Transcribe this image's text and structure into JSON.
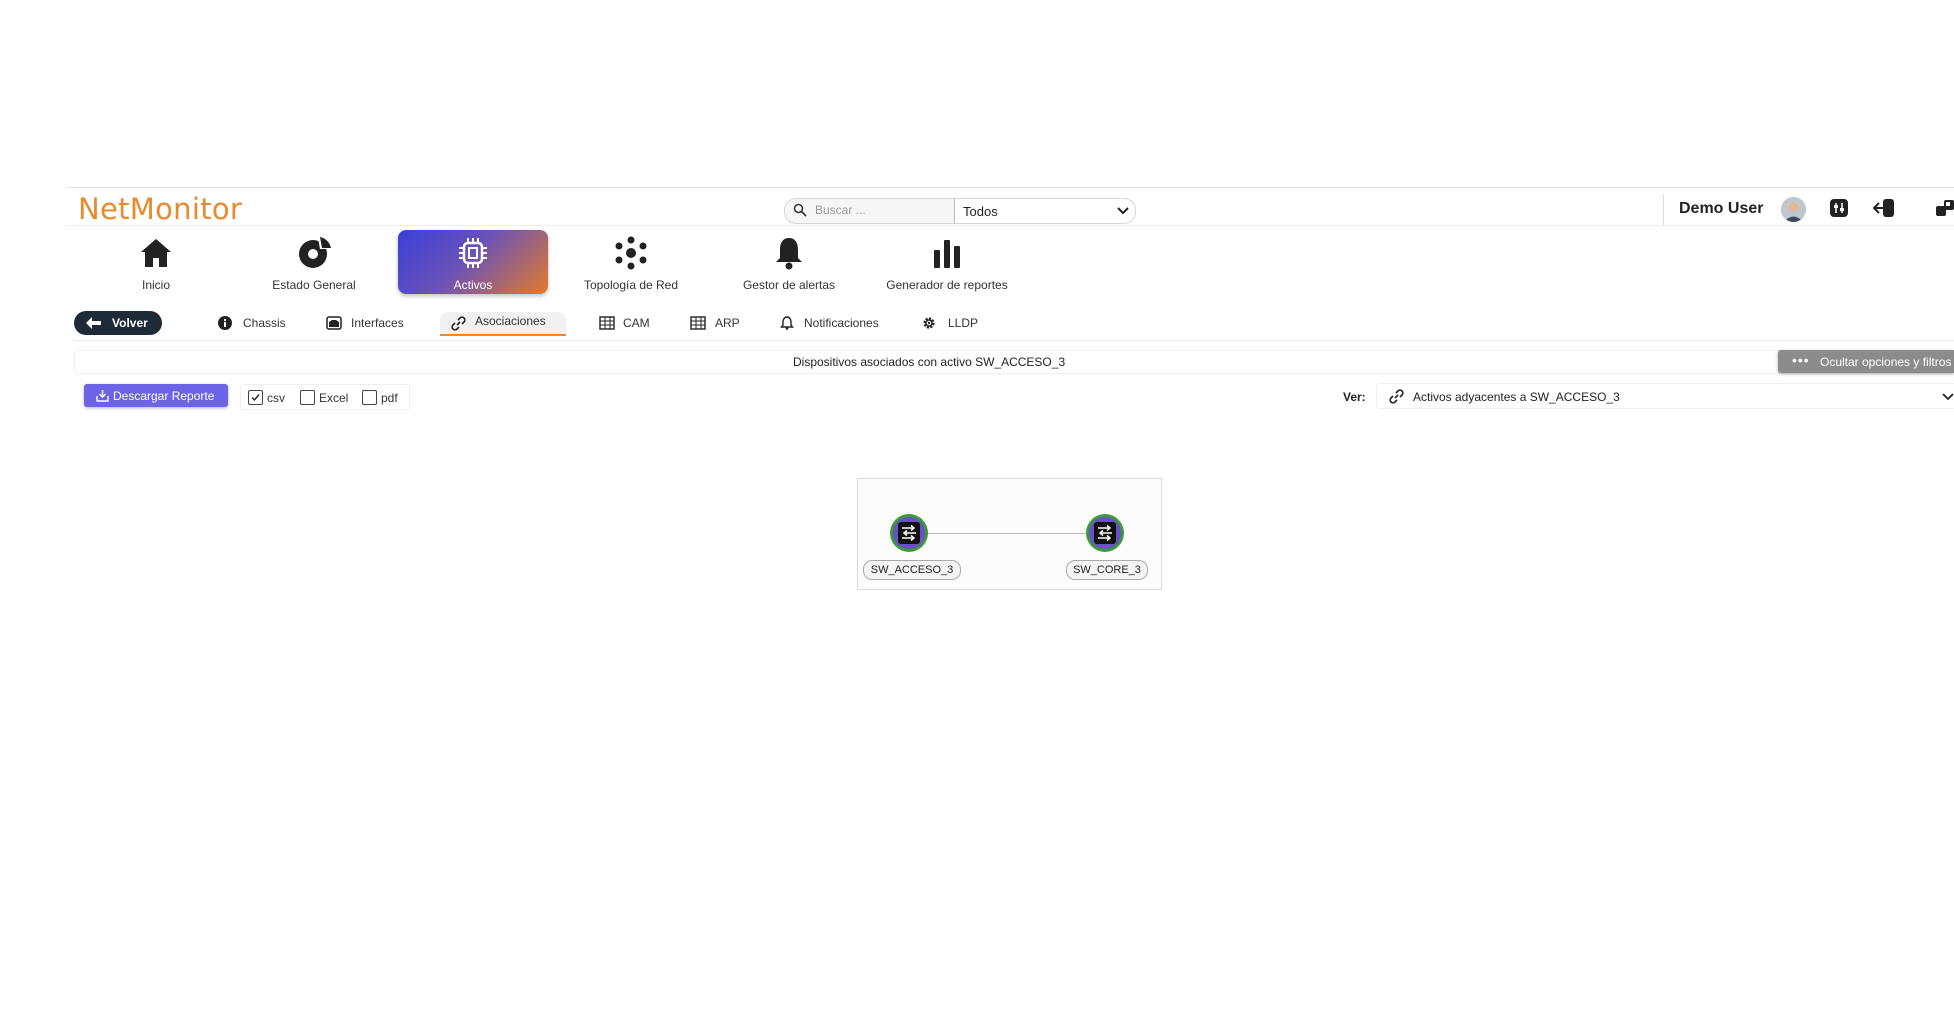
{
  "header": {
    "logo": "NetMonitor",
    "search_placeholder": "Buscar ...",
    "search_scope": "Todos",
    "username": "Demo User"
  },
  "nav": {
    "items": [
      {
        "label": "Inicio",
        "icon": "home-icon"
      },
      {
        "label": "Estado General",
        "icon": "status-icon"
      },
      {
        "label": "Activos",
        "icon": "chip-icon",
        "active": true
      },
      {
        "label": "Topología de Red",
        "icon": "topology-icon"
      },
      {
        "label": "Gestor de alertas",
        "icon": "bell-icon"
      },
      {
        "label": "Generador de reportes",
        "icon": "bar-chart-icon"
      }
    ]
  },
  "subnav": {
    "back_label": "Volver",
    "tabs": [
      {
        "label": "Chassis",
        "icon": "info-icon"
      },
      {
        "label": "Interfaces",
        "icon": "interfaces-icon"
      },
      {
        "label": "Asociaciones",
        "icon": "link-icon",
        "active": true
      },
      {
        "label": "CAM",
        "icon": "table-icon"
      },
      {
        "label": "ARP",
        "icon": "table-icon"
      },
      {
        "label": "Notificaciones",
        "icon": "bell-icon"
      },
      {
        "label": "LLDP",
        "icon": "gear-icon"
      }
    ]
  },
  "panel": {
    "title": "Dispositivos asociados con activo SW_ACCESO_3",
    "hide_options_label": "Ocultar opciones y filtros",
    "download_label": "Descargar Reporte",
    "formats": [
      {
        "label": "csv",
        "checked": true
      },
      {
        "label": "Excel",
        "checked": false
      },
      {
        "label": "pdf",
        "checked": false
      }
    ],
    "view_label": "Ver:",
    "view_value": "Activos adyacentes a SW_ACCESO_3"
  },
  "diagram": {
    "nodes": [
      {
        "label": "SW_ACCESO_3",
        "icon": "switch-icon"
      },
      {
        "label": "SW_CORE_3",
        "icon": "switch-icon"
      }
    ]
  },
  "colors": {
    "brand_orange": "#e88a2e",
    "active_gradient_start": "#3a3fd8",
    "active_gradient_end": "#e27b2a",
    "button_purple": "#6c63e6",
    "node_green": "#3c9a3a",
    "node_purple": "#6b4fc7"
  }
}
